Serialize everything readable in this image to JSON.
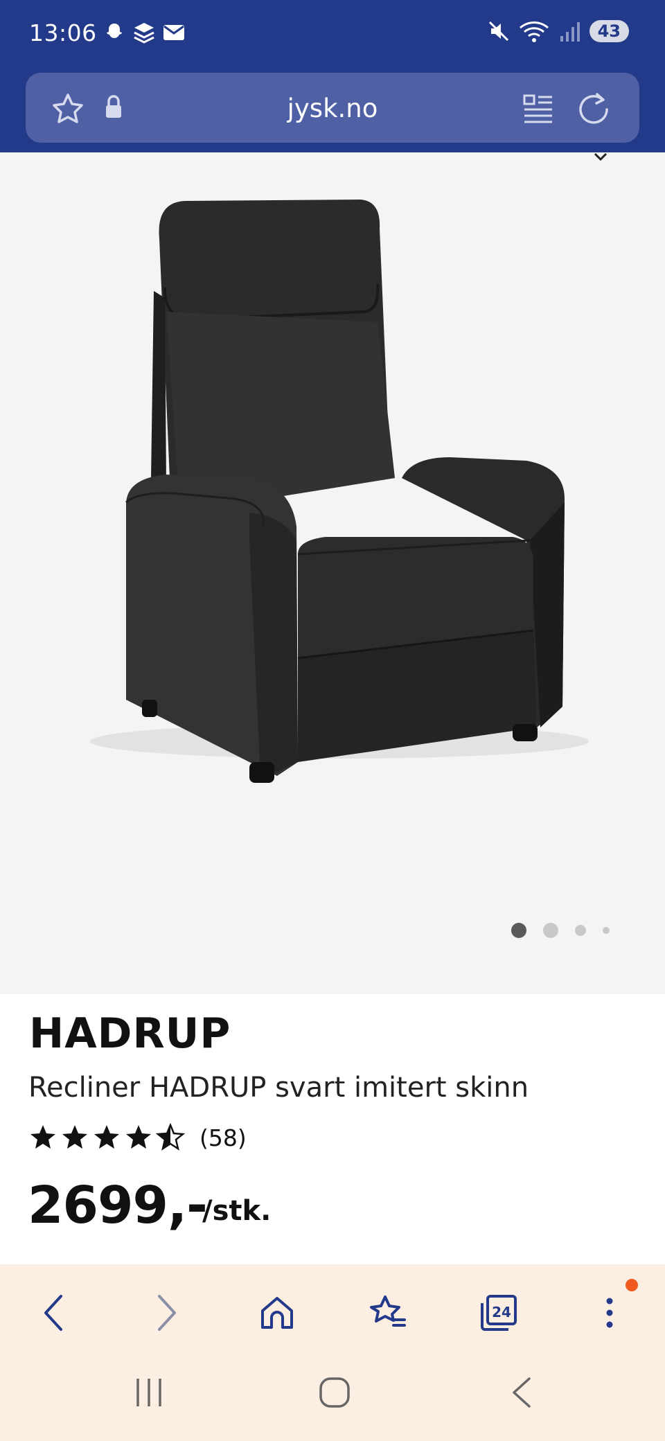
{
  "status_bar": {
    "time": "13:06",
    "battery": "43",
    "icons": [
      "snapchat-icon",
      "layers-icon",
      "mail-icon",
      "mute-icon",
      "wifi-icon",
      "signal-icon"
    ]
  },
  "browser": {
    "url": "jysk.no",
    "icons": [
      "bookmark-star-icon",
      "lock-icon",
      "reader-mode-icon",
      "reload-icon"
    ]
  },
  "product": {
    "carousel": {
      "total": 4,
      "active": 1
    },
    "brand": "HADRUP",
    "subtitle": "Recliner HADRUP svart imitert skinn",
    "rating": 4.5,
    "rating_count": "(58)",
    "price": "2699,-",
    "unit": "/stk."
  },
  "bottom_nav": {
    "tab_count": "24",
    "icons": [
      "back-icon",
      "forward-icon",
      "home-icon",
      "bookmarks-icon",
      "tabs-icon",
      "more-icon"
    ]
  },
  "colors": {
    "header": "#23398a",
    "url_field": "#5060a5",
    "bottom_bar": "#fdeee2",
    "notification": "#f05a1e"
  }
}
